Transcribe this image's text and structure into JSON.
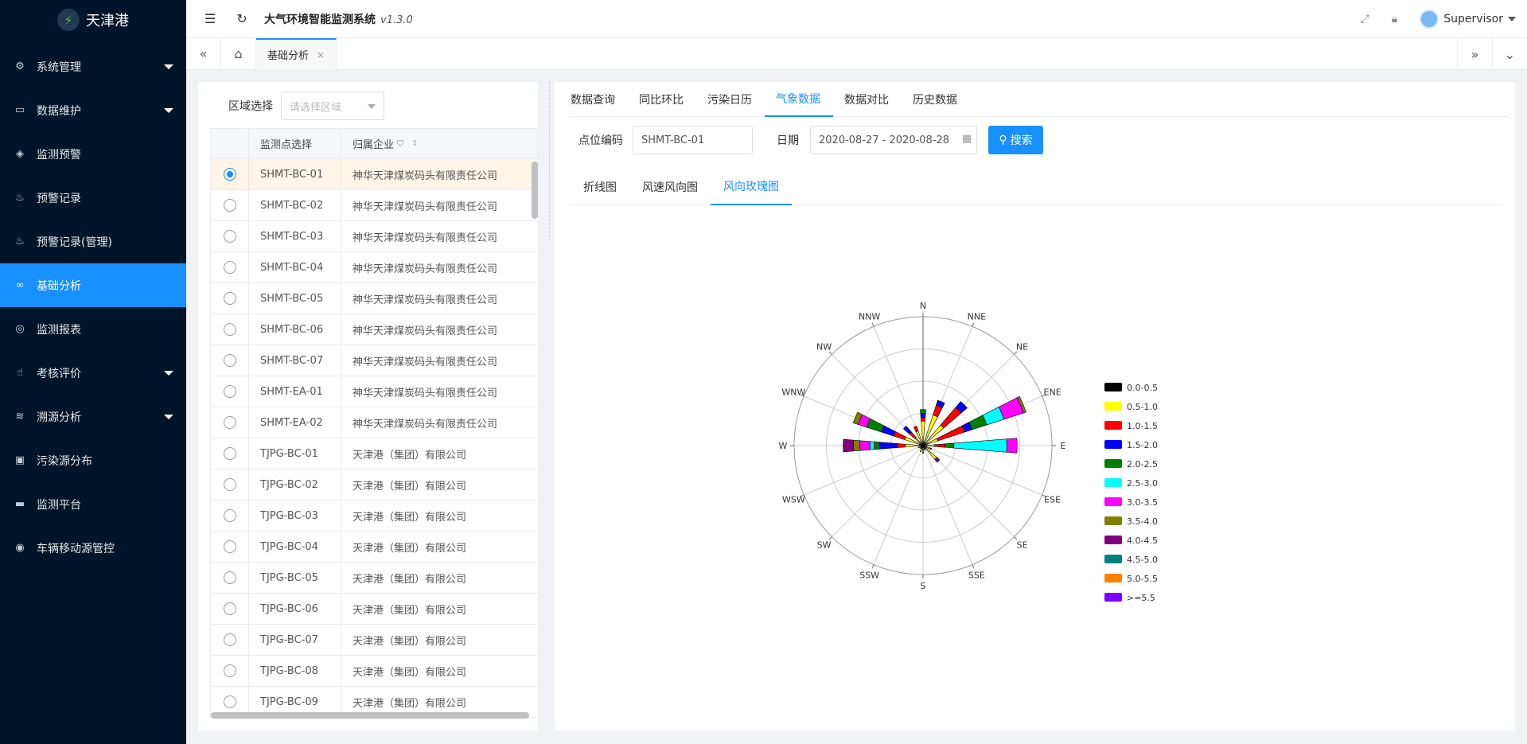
{
  "app": {
    "name": "天津港",
    "title": "大气环境智能监测系统",
    "version": "v1.3.0",
    "user": "Supervisor"
  },
  "sidebar": {
    "items": [
      {
        "label": "系统管理",
        "icon": "gear-icon",
        "glyph": "⚙",
        "caret": true
      },
      {
        "label": "数据维护",
        "icon": "book-icon",
        "glyph": "▭",
        "caret": true
      },
      {
        "label": "监测预警",
        "icon": "shield-icon",
        "glyph": "◈",
        "caret": false
      },
      {
        "label": "预警记录",
        "icon": "fire-icon",
        "glyph": "♨",
        "caret": false
      },
      {
        "label": "预警记录(管理)",
        "icon": "fire-icon",
        "glyph": "♨",
        "caret": false
      },
      {
        "label": "基础分析",
        "icon": "link-icon",
        "glyph": "∞",
        "caret": false,
        "active": true
      },
      {
        "label": "监测报表",
        "icon": "cube-icon",
        "glyph": "◎",
        "caret": false
      },
      {
        "label": "考核评价",
        "icon": "thumb-icon",
        "glyph": "☝",
        "caret": true
      },
      {
        "label": "溯源分析",
        "icon": "layers-icon",
        "glyph": "≋",
        "caret": true
      },
      {
        "label": "污染源分布",
        "icon": "image-icon",
        "glyph": "▣",
        "caret": false
      },
      {
        "label": "监测平台",
        "icon": "message-icon",
        "glyph": "▬",
        "caret": false
      },
      {
        "label": "车辆移动源管控",
        "icon": "location-icon",
        "glyph": "◉",
        "caret": false
      }
    ]
  },
  "tabs": {
    "current": "基础分析",
    "close": "×"
  },
  "left": {
    "region_label": "区域选择",
    "region_placeholder": "请选择区域",
    "col_point": "监测点选择",
    "col_company": "归属企业",
    "rows": [
      {
        "code": "SHMT-BC-01",
        "company": "神华天津煤炭码头有限责任公司",
        "selected": true
      },
      {
        "code": "SHMT-BC-02",
        "company": "神华天津煤炭码头有限责任公司"
      },
      {
        "code": "SHMT-BC-03",
        "company": "神华天津煤炭码头有限责任公司"
      },
      {
        "code": "SHMT-BC-04",
        "company": "神华天津煤炭码头有限责任公司"
      },
      {
        "code": "SHMT-BC-05",
        "company": "神华天津煤炭码头有限责任公司"
      },
      {
        "code": "SHMT-BC-06",
        "company": "神华天津煤炭码头有限责任公司"
      },
      {
        "code": "SHMT-BC-07",
        "company": "神华天津煤炭码头有限责任公司"
      },
      {
        "code": "SHMT-EA-01",
        "company": "神华天津煤炭码头有限责任公司"
      },
      {
        "code": "SHMT-EA-02",
        "company": "神华天津煤炭码头有限责任公司"
      },
      {
        "code": "TJPG-BC-01",
        "company": "天津港（集团）有限公司"
      },
      {
        "code": "TJPG-BC-02",
        "company": "天津港（集团）有限公司"
      },
      {
        "code": "TJPG-BC-03",
        "company": "天津港（集团）有限公司"
      },
      {
        "code": "TJPG-BC-04",
        "company": "天津港（集团）有限公司"
      },
      {
        "code": "TJPG-BC-05",
        "company": "天津港（集团）有限公司"
      },
      {
        "code": "TJPG-BC-06",
        "company": "天津港（集团）有限公司"
      },
      {
        "code": "TJPG-BC-07",
        "company": "天津港（集团）有限公司"
      },
      {
        "code": "TJPG-BC-08",
        "company": "天津港（集团）有限公司"
      },
      {
        "code": "TJPG-BC-09",
        "company": "天津港（集团）有限公司"
      }
    ]
  },
  "right": {
    "tabs": [
      "数据查询",
      "同比环比",
      "污染日历",
      "气象数据",
      "数据对比",
      "历史数据"
    ],
    "active_tab": 3,
    "point_label": "点位编码",
    "point_value": "SHMT-BC-01",
    "date_label": "日期",
    "date_value": "2020-08-27 - 2020-08-28",
    "search_label": "搜索",
    "subtabs": [
      "折线图",
      "风速风向图",
      "风向玫瑰图"
    ],
    "active_subtab": 2
  },
  "chart_data": {
    "type": "windrose",
    "directions": [
      "N",
      "NNE",
      "NE",
      "ENE",
      "E",
      "ESE",
      "SE",
      "SSE",
      "S",
      "SSW",
      "SW",
      "WSW",
      "W",
      "WNW",
      "NW",
      "NNW"
    ],
    "radial_max": 10,
    "rings": 4,
    "legend": [
      {
        "name": "0.0-0.5",
        "color": "#000000"
      },
      {
        "name": "0.5-1.0",
        "color": "#ffff00"
      },
      {
        "name": "1.0-1.5",
        "color": "#ff0000"
      },
      {
        "name": "1.5-2.0",
        "color": "#0000ff"
      },
      {
        "name": "2.0-2.5",
        "color": "#008000"
      },
      {
        "name": "2.5-3.0",
        "color": "#00ffff"
      },
      {
        "name": "3.0-3.5",
        "color": "#ff00ff"
      },
      {
        "name": "3.5-4.0",
        "color": "#808000"
      },
      {
        "name": "4.0-4.5",
        "color": "#800080"
      },
      {
        "name": "4.5-5.0",
        "color": "#008080"
      },
      {
        "name": "5.0-5.5",
        "color": "#ff8000"
      },
      {
        "name": ">=5.5",
        "color": "#8000ff"
      }
    ],
    "series": [
      {
        "dir": "N",
        "values": [
          0.3,
          1.6,
          0.3,
          0.3,
          0.3,
          0,
          0,
          0,
          0,
          0,
          0,
          0
        ]
      },
      {
        "dir": "NNE",
        "values": [
          0.3,
          2.2,
          0.8,
          0.4,
          0,
          0,
          0,
          0,
          0,
          0,
          0,
          0
        ]
      },
      {
        "dir": "NE",
        "values": [
          0.3,
          1.8,
          1.8,
          0.6,
          0,
          0,
          0,
          0,
          0,
          0,
          0,
          0
        ]
      },
      {
        "dir": "ENE",
        "values": [
          0.4,
          0.8,
          2.2,
          0.6,
          1.2,
          1.4,
          1.6,
          0.2,
          0,
          0,
          0,
          0
        ]
      },
      {
        "dir": "E",
        "values": [
          0.3,
          0.6,
          0.8,
          0,
          0.7,
          4.1,
          0.8,
          0,
          0,
          0,
          0,
          0
        ]
      },
      {
        "dir": "ESE",
        "values": [
          0.3,
          0.3,
          0.1,
          0,
          0,
          0,
          0,
          0,
          0,
          0,
          0,
          0
        ]
      },
      {
        "dir": "SE",
        "values": [
          0.3,
          1.1,
          0,
          0,
          0,
          0,
          0,
          0,
          0.3,
          0,
          0,
          0
        ]
      },
      {
        "dir": "SSE",
        "values": [
          0.2,
          0.2,
          0,
          0,
          0,
          0,
          0,
          0,
          0,
          0,
          0,
          0
        ]
      },
      {
        "dir": "S",
        "values": [
          0.3,
          0.3,
          0,
          0,
          0,
          0,
          0,
          0,
          0,
          0,
          0,
          0
        ]
      },
      {
        "dir": "SSW",
        "values": [
          0.2,
          0.3,
          0,
          0,
          0,
          0,
          0,
          0,
          0,
          0,
          0,
          0
        ]
      },
      {
        "dir": "SW",
        "values": [
          0.2,
          0.1,
          0,
          0,
          0,
          0,
          0,
          0,
          0,
          0,
          0,
          0
        ]
      },
      {
        "dir": "WSW",
        "values": [
          0.2,
          0.2,
          0,
          0,
          0,
          0,
          0,
          0,
          0,
          0,
          0,
          0
        ]
      },
      {
        "dir": "W",
        "values": [
          0.3,
          1.1,
          0.6,
          1.4,
          0.4,
          0.3,
          0.8,
          0.5,
          0.8,
          0,
          0,
          0
        ]
      },
      {
        "dir": "WNW",
        "values": [
          0.3,
          1.2,
          0.9,
          1.0,
          1.2,
          0,
          0.7,
          0.4,
          0,
          0,
          0,
          0
        ]
      },
      {
        "dir": "NW",
        "values": [
          0.3,
          0.5,
          0.6,
          0.6,
          0,
          0,
          0,
          0,
          0,
          0,
          0,
          0
        ]
      },
      {
        "dir": "NNW",
        "values": [
          0.3,
          0.9,
          0.4,
          0,
          0,
          0,
          0,
          0,
          0,
          0,
          0,
          0
        ]
      }
    ]
  }
}
